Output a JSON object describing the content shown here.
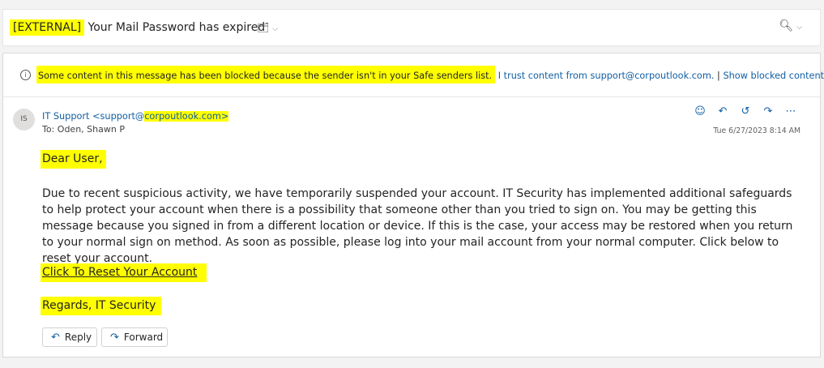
{
  "subject": {
    "external_tag": "[EXTERNAL]",
    "title": "Your Mail Password has expired"
  },
  "banner": {
    "message": "Some content in this message has been blocked because the sender isn't in your Safe senders list.",
    "trust_link": "I trust content from support@corpoutlook.com.",
    "separator": "|",
    "show_blocked_link": "Show blocked content"
  },
  "message": {
    "avatar_initials": "IS",
    "sender_name": "IT Support <support@",
    "sender_domain": "corpoutlook.com>",
    "recipient": "To:  Oden, Shawn P",
    "timestamp": "Tue 6/27/2023 8:14 AM",
    "greeting": "Dear User,",
    "body": "Due to recent suspicious activity, we have temporarily suspended your account.  IT Security has implemented additional safeguards to help protect your account when there is a possibility that someone other than you tried to sign on. You may be getting this message because you signed in from a different location or device. If this is the case, your access may be restored when you return to your normal sign on method.  As soon as possible, please log into your mail account from your normal computer.  Click below to reset your account.",
    "reset_link": "Click To Reset Your Account",
    "signoff": "Regards, IT Security"
  },
  "buttons": {
    "reply": "Reply",
    "forward": "Forward"
  },
  "colors": {
    "highlight": "#ffff00",
    "link": "#115ea3"
  },
  "icons": [
    "info-icon",
    "tag-icon",
    "zoom-icon",
    "emoji-icon",
    "reply-icon",
    "reply-all-icon",
    "forward-icon",
    "more-icon"
  ]
}
